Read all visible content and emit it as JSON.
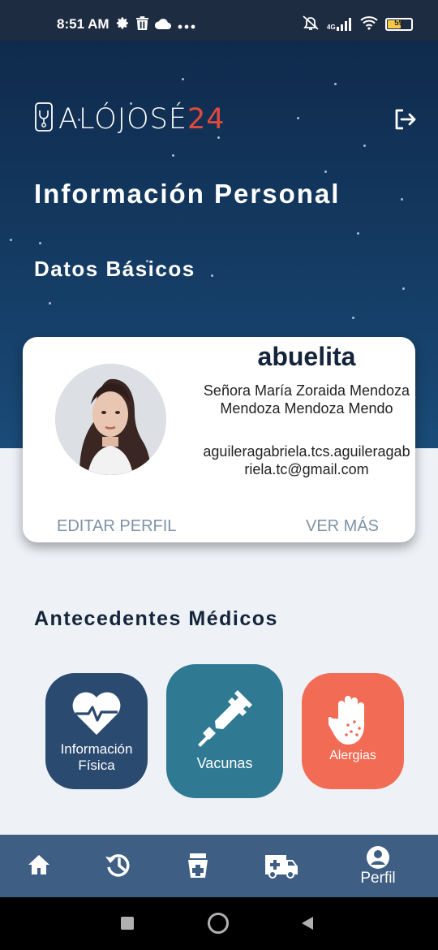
{
  "status_bar": {
    "time": "8:51 AM",
    "network_label": "4G",
    "battery_level": "59",
    "battery_percent": 59,
    "icons": [
      "settings-icon",
      "trash-icon",
      "cloud-icon",
      "more-dots-icon",
      "alarm-off-icon",
      "signal-icon",
      "wifi-icon",
      "battery-icon"
    ]
  },
  "header": {
    "logo_text": "ALÓJOSÉ",
    "logo_number": "24",
    "logout_icon": "logout-icon"
  },
  "page": {
    "title": "Información Personal",
    "section_title": "Datos Básicos"
  },
  "profile": {
    "nickname": "abuelita",
    "full_name": "Señora María Zoraida Mendoza Mendoza Mendoza Mendo",
    "email": "aguileragabriela.tcs.aguileragabriela.tc@gmail.com",
    "edit_label": "EDITAR PERFIL",
    "more_label": "VER MÁS"
  },
  "medical": {
    "title": "Antecedentes Médicos",
    "tiles": [
      {
        "label": "Información Física",
        "icon": "heart-pulse-icon",
        "color": "#2a4a70"
      },
      {
        "label": "Vacunas",
        "icon": "syringe-icon",
        "color": "#2f7992"
      },
      {
        "label": "Alergias",
        "icon": "allergy-hand-icon",
        "color": "#f26b55"
      }
    ]
  },
  "bottom_nav": {
    "items": [
      {
        "icon": "home-icon",
        "label": ""
      },
      {
        "icon": "history-icon",
        "label": ""
      },
      {
        "icon": "prescription-icon",
        "label": ""
      },
      {
        "icon": "ambulance-icon",
        "label": ""
      },
      {
        "icon": "user-circle-icon",
        "label": "Perfil"
      }
    ]
  },
  "colors": {
    "hero_top": "#0f2a4c",
    "hero_bottom": "#1a4b78",
    "logo_accent": "#e04a3c",
    "nav_bg": "#3f5e83",
    "page_bg": "#eef2f7"
  }
}
